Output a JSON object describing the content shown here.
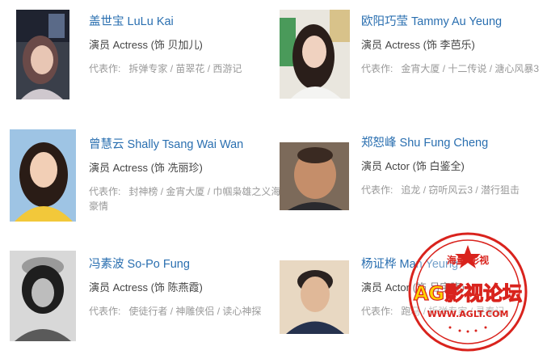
{
  "cast": [
    {
      "name": "盖世宝 LuLu Kai",
      "role": "演员 Actress (饰 贝加儿)",
      "works_label": "代表作:",
      "works": "拆弹专家 / 苗翠花 / 西游记"
    },
    {
      "name": "欧阳巧莹 Tammy Au Yeung",
      "role": "演员 Actress (饰 李芭乐)",
      "works_label": "代表作:",
      "works": "金宵大厦 / 十二传说 / 溏心风暴3"
    },
    {
      "name": "曾慧云 Shally Tsang Wai Wan",
      "role": "演员 Actress (饰 冼丽珍)",
      "works_label": "代表作:",
      "works": "封神榜 / 金宵大厦 / 巾帼枭雄之义海豪情"
    },
    {
      "name": "郑恕峰 Shu Fung Cheng",
      "role": "演员 Actor (饰 白鉴全)",
      "works_label": "代表作:",
      "works": "追龙 / 窃听风云3 / 潜行狙击"
    },
    {
      "name": "冯素波 So-Po Fung",
      "role": "演员 Actress (饰 陈燕霞)",
      "works_label": "代表作:",
      "works": "使徒行者 / 神雕侠侣 / 读心神探"
    },
    {
      "name": "杨证桦 Man Yeung",
      "role": "演员 Actor (饰 吕宇晓)",
      "works_label": "代表作:",
      "works": "跑马 / 拆弹专家 / 寻秦记"
    }
  ],
  "watermark": {
    "top_text": "海量  影视",
    "main_text": "AG影视论坛",
    "url_text": "WWW.AGLT.COM",
    "color": "#d9231d",
    "fill_color": "#ffd400"
  }
}
